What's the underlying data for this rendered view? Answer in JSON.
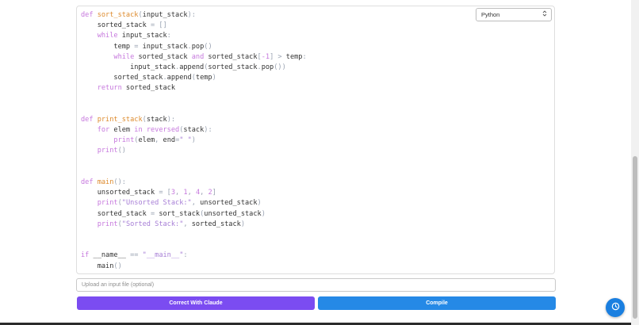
{
  "editor": {
    "language": "Python",
    "code": [
      [
        [
          "def ",
          "kw"
        ],
        [
          "sort_stack",
          "fn"
        ],
        [
          "(",
          "p"
        ],
        [
          "input_stack",
          ""
        ],
        [
          "):",
          "p"
        ]
      ],
      [
        [
          "    sorted_stack ",
          ""
        ],
        [
          "= []",
          "p"
        ]
      ],
      [
        [
          "    ",
          ""
        ],
        [
          "while ",
          "kw"
        ],
        [
          "input_stack",
          ""
        ],
        [
          ":",
          "p"
        ]
      ],
      [
        [
          "        temp ",
          ""
        ],
        [
          "= ",
          "p"
        ],
        [
          "input_stack",
          ""
        ],
        [
          ".",
          "p"
        ],
        [
          "pop",
          ""
        ],
        [
          "()",
          "p"
        ]
      ],
      [
        [
          "        ",
          ""
        ],
        [
          "while ",
          "kw"
        ],
        [
          "sorted_stack ",
          ""
        ],
        [
          "and ",
          "kw"
        ],
        [
          "sorted_stack",
          ""
        ],
        [
          "[",
          "p"
        ],
        [
          "-1",
          "n"
        ],
        [
          "] > ",
          "p"
        ],
        [
          "temp",
          ""
        ],
        [
          ":",
          "p"
        ]
      ],
      [
        [
          "            input_stack",
          ""
        ],
        [
          ".",
          "p"
        ],
        [
          "append",
          ""
        ],
        [
          "(",
          "p"
        ],
        [
          "sorted_stack",
          ""
        ],
        [
          ".",
          "p"
        ],
        [
          "pop",
          ""
        ],
        [
          "())",
          "p"
        ]
      ],
      [
        [
          "        sorted_stack",
          ""
        ],
        [
          ".",
          "p"
        ],
        [
          "append",
          ""
        ],
        [
          "(",
          "p"
        ],
        [
          "temp",
          ""
        ],
        [
          ")",
          "p"
        ]
      ],
      [
        [
          "    ",
          ""
        ],
        [
          "return ",
          "kw"
        ],
        [
          "sorted_stack",
          ""
        ]
      ],
      [],
      [],
      [
        [
          "def ",
          "kw"
        ],
        [
          "print_stack",
          "fn"
        ],
        [
          "(",
          "p"
        ],
        [
          "stack",
          ""
        ],
        [
          "):",
          "p"
        ]
      ],
      [
        [
          "    ",
          ""
        ],
        [
          "for ",
          "kw"
        ],
        [
          "elem ",
          ""
        ],
        [
          "in ",
          "kw"
        ],
        [
          "reversed",
          "bi"
        ],
        [
          "(",
          "p"
        ],
        [
          "stack",
          ""
        ],
        [
          "):",
          "p"
        ]
      ],
      [
        [
          "        ",
          ""
        ],
        [
          "print",
          "bi"
        ],
        [
          "(",
          "p"
        ],
        [
          "elem",
          ""
        ],
        [
          ", ",
          "p"
        ],
        [
          "end",
          ""
        ],
        [
          "=",
          "p"
        ],
        [
          "\" \"",
          "s"
        ],
        [
          ")",
          "p"
        ]
      ],
      [
        [
          "    ",
          ""
        ],
        [
          "print",
          "bi"
        ],
        [
          "()",
          "p"
        ]
      ],
      [],
      [],
      [
        [
          "def ",
          "kw"
        ],
        [
          "main",
          "fn"
        ],
        [
          "():",
          "p"
        ]
      ],
      [
        [
          "    unsorted_stack ",
          ""
        ],
        [
          "= [",
          "p"
        ],
        [
          "3",
          "n"
        ],
        [
          ", ",
          "p"
        ],
        [
          "1",
          "n"
        ],
        [
          ", ",
          "p"
        ],
        [
          "4",
          "n"
        ],
        [
          ", ",
          "p"
        ],
        [
          "2",
          "n"
        ],
        [
          "]",
          "p"
        ]
      ],
      [
        [
          "    ",
          ""
        ],
        [
          "print",
          "bi"
        ],
        [
          "(",
          "p"
        ],
        [
          "\"Unsorted Stack:\"",
          "s"
        ],
        [
          ", ",
          "p"
        ],
        [
          "unsorted_stack",
          ""
        ],
        [
          ")",
          "p"
        ]
      ],
      [
        [
          "    sorted_stack ",
          ""
        ],
        [
          "= ",
          "p"
        ],
        [
          "sort_stack",
          ""
        ],
        [
          "(",
          "p"
        ],
        [
          "unsorted_stack",
          ""
        ],
        [
          ")",
          "p"
        ]
      ],
      [
        [
          "    ",
          ""
        ],
        [
          "print",
          "bi"
        ],
        [
          "(",
          "p"
        ],
        [
          "\"Sorted Stack:\"",
          "s"
        ],
        [
          ", ",
          "p"
        ],
        [
          "sorted_stack",
          ""
        ],
        [
          ")",
          "p"
        ]
      ],
      [],
      [],
      [
        [
          "if ",
          "kw"
        ],
        [
          "__name__ ",
          ""
        ],
        [
          "== ",
          "p"
        ],
        [
          "\"__main__\"",
          "s"
        ],
        [
          ":",
          "p"
        ]
      ],
      [
        [
          "    main",
          ""
        ],
        [
          "()",
          "p"
        ]
      ]
    ]
  },
  "file_input": {
    "placeholder": "Upload an input file (optional)"
  },
  "buttons": {
    "correct_label": "Correct With Claude",
    "compile_label": "Compile"
  },
  "fab": {
    "icon": "clock-icon"
  },
  "colors": {
    "claude_button": "#7b4cf1",
    "compile_button": "#2589e6",
    "fab": "#1a7fe0"
  }
}
